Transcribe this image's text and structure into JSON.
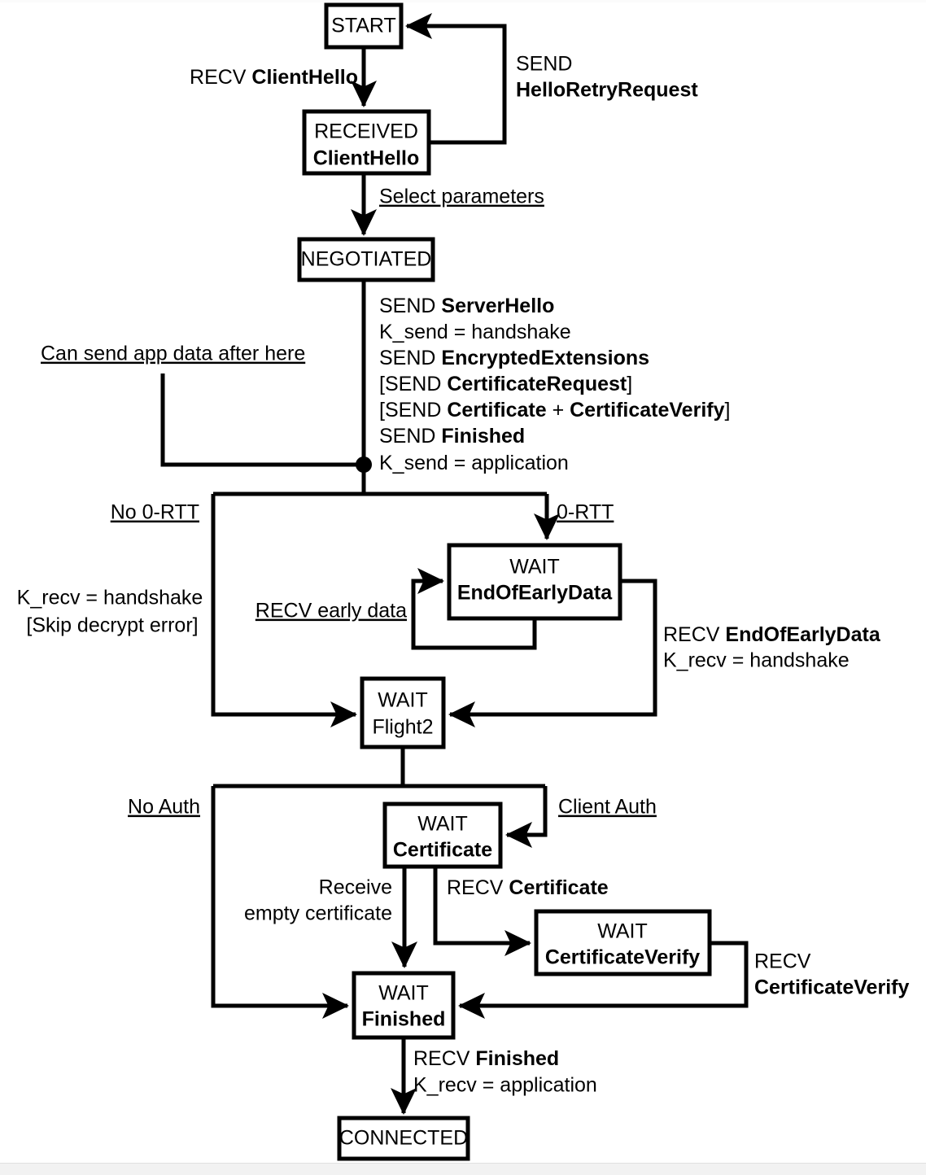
{
  "diagram": {
    "title": "TLS 1.3 Server State Machine",
    "type": "state-machine-flowchart",
    "colors": {
      "background": "#ffffff",
      "stroke": "#000000",
      "text": "#000000"
    },
    "states": {
      "start": {
        "line1": "START",
        "line2": ""
      },
      "received_ch": {
        "line1": "RECEIVED",
        "line2": "ClientHello"
      },
      "negotiated": {
        "line1": "NEGOTIATED",
        "line2": ""
      },
      "wait_eoed": {
        "line1": "WAIT",
        "line2": "EndOfEarlyData"
      },
      "wait_flight2": {
        "line1": "WAIT",
        "line2": "Flight2"
      },
      "wait_certificate": {
        "line1": "WAIT",
        "line2": "Certificate"
      },
      "wait_certverify": {
        "line1": "WAIT",
        "line2": "CertificateVerify"
      },
      "wait_finished": {
        "line1": "WAIT",
        "line2": "Finished"
      },
      "connected": {
        "line1": "CONNECTED",
        "line2": ""
      }
    },
    "transitions": {
      "recv_clienthello": {
        "plain": "RECV ",
        "bold": "ClientHello"
      },
      "send_hrr_line1": "SEND",
      "send_hrr_line2": "HelloRetryRequest",
      "select_parameters": "Select parameters",
      "can_send_app_data": "Can send app data after here",
      "negotiated_actions": [
        {
          "plain1": "SEND ",
          "bold1": "ServerHello",
          "plain2": "",
          "bold2": "",
          "plain3": ""
        },
        {
          "plain1": "K_send = handshake",
          "bold1": "",
          "plain2": "",
          "bold2": "",
          "plain3": ""
        },
        {
          "plain1": "SEND ",
          "bold1": "EncryptedExtensions",
          "plain2": "",
          "bold2": "",
          "plain3": ""
        },
        {
          "plain1": "[SEND ",
          "bold1": "CertificateRequest",
          "plain2": "]",
          "bold2": "",
          "plain3": ""
        },
        {
          "plain1": "[SEND ",
          "bold1": "Certificate",
          "plain2": " + ",
          "bold2": "CertificateVerify",
          "plain3": "]"
        },
        {
          "plain1": "SEND ",
          "bold1": "Finished",
          "plain2": "",
          "bold2": "",
          "plain3": ""
        },
        {
          "plain1": "K_send = application",
          "bold1": "",
          "plain2": "",
          "bold2": "",
          "plain3": ""
        }
      ],
      "no_0rtt": "No 0-RTT",
      "zero_rtt": "0-RTT",
      "k_recv_handshake": "K_recv =  handshake",
      "skip_decrypt_error": "[Skip decrypt error]",
      "recv_early_data": "RECV early data",
      "recv_eoed": {
        "plain": "RECV ",
        "bold": "EndOfEarlyData"
      },
      "recv_eoed_key": "K_recv = handshake",
      "no_auth": "No Auth",
      "client_auth": "Client Auth",
      "receive_empty_cert_l1": "Receive",
      "receive_empty_cert_l2": "empty certificate",
      "recv_certificate": {
        "plain": "RECV ",
        "bold": "Certificate"
      },
      "recv_certverify_l1": "RECV",
      "recv_certverify_l2": "CertificateVerify",
      "recv_finished": {
        "plain": "RECV ",
        "bold": "Finished"
      },
      "recv_finished_key": "K_recv = application"
    }
  }
}
